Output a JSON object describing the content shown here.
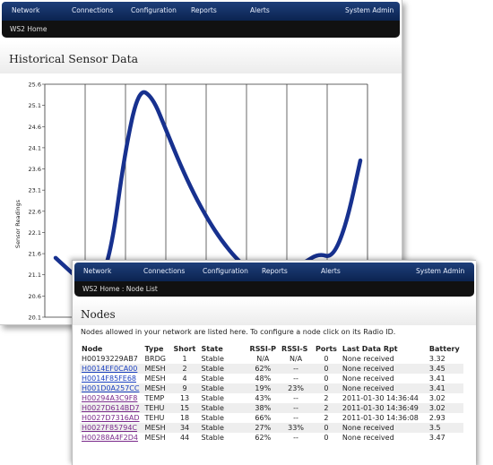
{
  "nav": [
    "Network",
    "Connections",
    "Configuration",
    "Reports",
    "Alerts",
    "System Admin"
  ],
  "back_window": {
    "breadcrumb": "WS2 Home",
    "title": "Historical Sensor Data"
  },
  "chart_data": {
    "type": "line",
    "ylabel": "Sensor Readings",
    "yticks": [
      "25.6",
      "25.1",
      "24.6",
      "24.1",
      "23.6",
      "23.1",
      "22.6",
      "22.1",
      "21.6",
      "21.1",
      "20.6",
      "20.1"
    ],
    "ylim": [
      20.1,
      25.6
    ],
    "color": "#17318f",
    "x": [
      0,
      1,
      2,
      3,
      4,
      5,
      6,
      7,
      8,
      9,
      10,
      11,
      12,
      13,
      14,
      15,
      16,
      17,
      18,
      19,
      20,
      21,
      22
    ],
    "values": [
      21.5,
      21.2,
      20.9,
      20.8,
      21.6,
      24.0,
      25.5,
      25.3,
      24.5,
      23.7,
      23.0,
      22.4,
      21.9,
      21.5,
      21.2,
      21.0,
      21.0,
      21.2,
      21.4,
      21.6,
      21.5,
      22.3,
      23.8
    ]
  },
  "front_window": {
    "breadcrumb": "WS2 Home : Node List",
    "title": "Nodes",
    "intro": "Nodes allowed in your network are listed here. To configure a node click on its Radio ID.",
    "columns": [
      "Node",
      "Type",
      "Short",
      "State",
      "RSSI-P",
      "RSSI-S",
      "Ports",
      "Last Data Rpt",
      "Battery"
    ],
    "rows": [
      {
        "node": "H00193229AB7",
        "link": false,
        "type": "BRDG",
        "short": "1",
        "state": "Stable",
        "rssi_p": "N/A",
        "rssi_s": "N/A",
        "ports": "0",
        "last": "None received",
        "battery": "3.32"
      },
      {
        "node": "H0014EF0CA00",
        "link": true,
        "type": "MESH",
        "short": "2",
        "state": "Stable",
        "rssi_p": "62%",
        "rssi_s": "--",
        "ports": "0",
        "last": "None received",
        "battery": "3.45"
      },
      {
        "node": "H0014F85FE68",
        "link": true,
        "type": "MESH",
        "short": "4",
        "state": "Stable",
        "rssi_p": "48%",
        "rssi_s": "--",
        "ports": "0",
        "last": "None received",
        "battery": "3.41"
      },
      {
        "node": "H001D0A257CC",
        "link": true,
        "type": "MESH",
        "short": "9",
        "state": "Stable",
        "rssi_p": "19%",
        "rssi_s": "23%",
        "ports": "0",
        "last": "None received",
        "battery": "3.41"
      },
      {
        "node": "H00294A3C9F8",
        "link": true,
        "visited": true,
        "type": "TEMP",
        "short": "13",
        "state": "Stable",
        "rssi_p": "43%",
        "rssi_s": "--",
        "ports": "2",
        "last": "2011-01-30 14:36:44",
        "battery": "3.02"
      },
      {
        "node": "H0027D614BD7",
        "link": true,
        "visited": true,
        "type": "TEHU",
        "short": "15",
        "state": "Stable",
        "rssi_p": "38%",
        "rssi_s": "--",
        "ports": "2",
        "last": "2011-01-30 14:36:49",
        "battery": "3.02"
      },
      {
        "node": "H0027D7316AD",
        "link": true,
        "visited": true,
        "type": "TEHU",
        "short": "18",
        "state": "Stable",
        "rssi_p": "66%",
        "rssi_s": "--",
        "ports": "2",
        "last": "2011-01-30 14:36:08",
        "battery": "2.93"
      },
      {
        "node": "H0027F85794C",
        "link": true,
        "visited": true,
        "type": "MESH",
        "short": "34",
        "state": "Stable",
        "rssi_p": "27%",
        "rssi_s": "33%",
        "ports": "0",
        "last": "None received",
        "battery": "3.5"
      },
      {
        "node": "H00288A4F2D4",
        "link": true,
        "visited": true,
        "type": "MESH",
        "short": "44",
        "state": "Stable",
        "rssi_p": "62%",
        "rssi_s": "--",
        "ports": "0",
        "last": "None received",
        "battery": "3.47"
      }
    ]
  }
}
